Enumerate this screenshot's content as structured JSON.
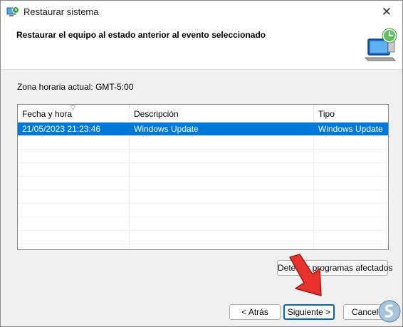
{
  "window": {
    "title": "Restaurar sistema",
    "close_glyph": "✕",
    "icon": "system-restore-icon"
  },
  "header": {
    "title": "Restaurar el equipo al estado anterior al evento seleccionado",
    "icon": "computer-restore-icon"
  },
  "timezone_label": "Zona horaria actual: GMT-5:00",
  "table": {
    "columns": [
      "Fecha y hora",
      "Descripción",
      "Tipo"
    ],
    "sort_glyph": "▽",
    "rows": [
      {
        "date": "21/05/2023 21:23:46",
        "description": "Windows Update",
        "type": "Windows Update",
        "selected": true
      }
    ]
  },
  "buttons": {
    "detect": "Detectar programas afectados",
    "back": "< Atrás",
    "next": "Siguiente >",
    "cancel": "Cancelar"
  },
  "colors": {
    "selection": "#0078d7",
    "arrow": "#e8322b",
    "accent": "#0067c0"
  }
}
